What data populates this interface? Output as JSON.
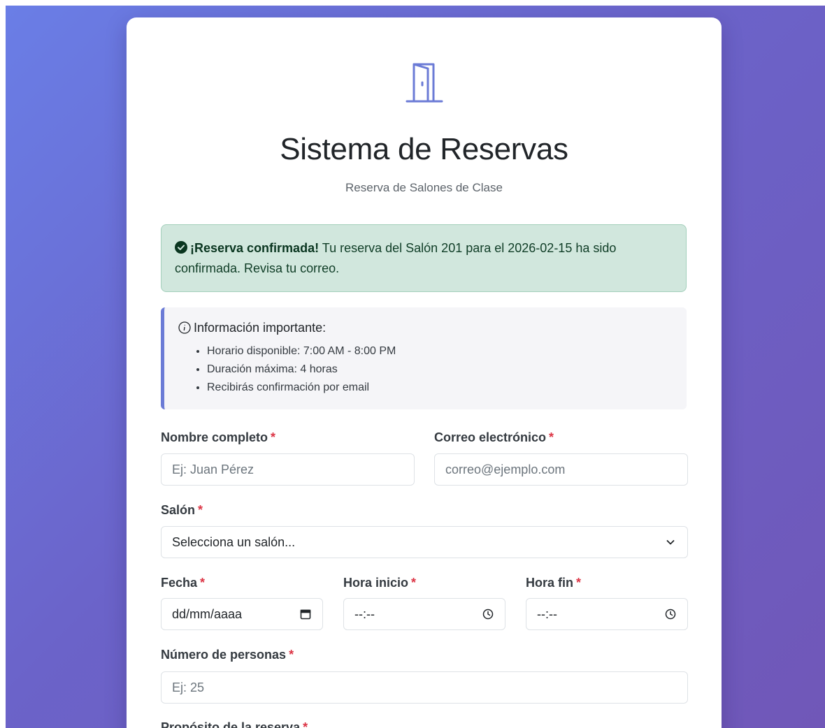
{
  "header": {
    "icon": "door-open-icon",
    "title": "Sistema de Reservas",
    "subtitle": "Reserva de Salones de Clase"
  },
  "alert": {
    "icon": "check-circle-icon",
    "strong": "¡Reserva confirmada!",
    "message": "Tu reserva del Salón 201 para el 2026-02-15 ha sido confirmada. Revisa tu correo.",
    "color": "#d1e7dd"
  },
  "info": {
    "icon": "info-circle-icon",
    "title": "Información importante:",
    "items": [
      "Horario disponible: 7:00 AM - 8:00 PM",
      "Duración máxima: 4 horas",
      "Recibirás confirmación por email"
    ],
    "accent": "#6b7bd6"
  },
  "form": {
    "required_mark": "*",
    "nombre": {
      "label": "Nombre completo",
      "placeholder": "Ej: Juan Pérez"
    },
    "correo": {
      "label": "Correo electrónico",
      "placeholder": "correo@ejemplo.com"
    },
    "salon": {
      "label": "Salón",
      "selected": "Selecciona un salón...",
      "icon": "chevron-down-icon"
    },
    "fecha": {
      "label": "Fecha",
      "value": "dd/mm/aaaa",
      "icon": "calendar-icon"
    },
    "hora_inicio": {
      "label": "Hora inicio",
      "value": "--:--",
      "icon": "clock-icon"
    },
    "hora_fin": {
      "label": "Hora fin",
      "value": "--:--",
      "icon": "clock-icon"
    },
    "personas": {
      "label": "Número de personas",
      "placeholder": "Ej: 25"
    },
    "proposito": {
      "label": "Propósito de la reserva"
    }
  },
  "colors": {
    "background_start": "#6a7ee6",
    "background_end": "#7057b8",
    "required": "#dc3545",
    "icon": "#6b7bd6"
  }
}
